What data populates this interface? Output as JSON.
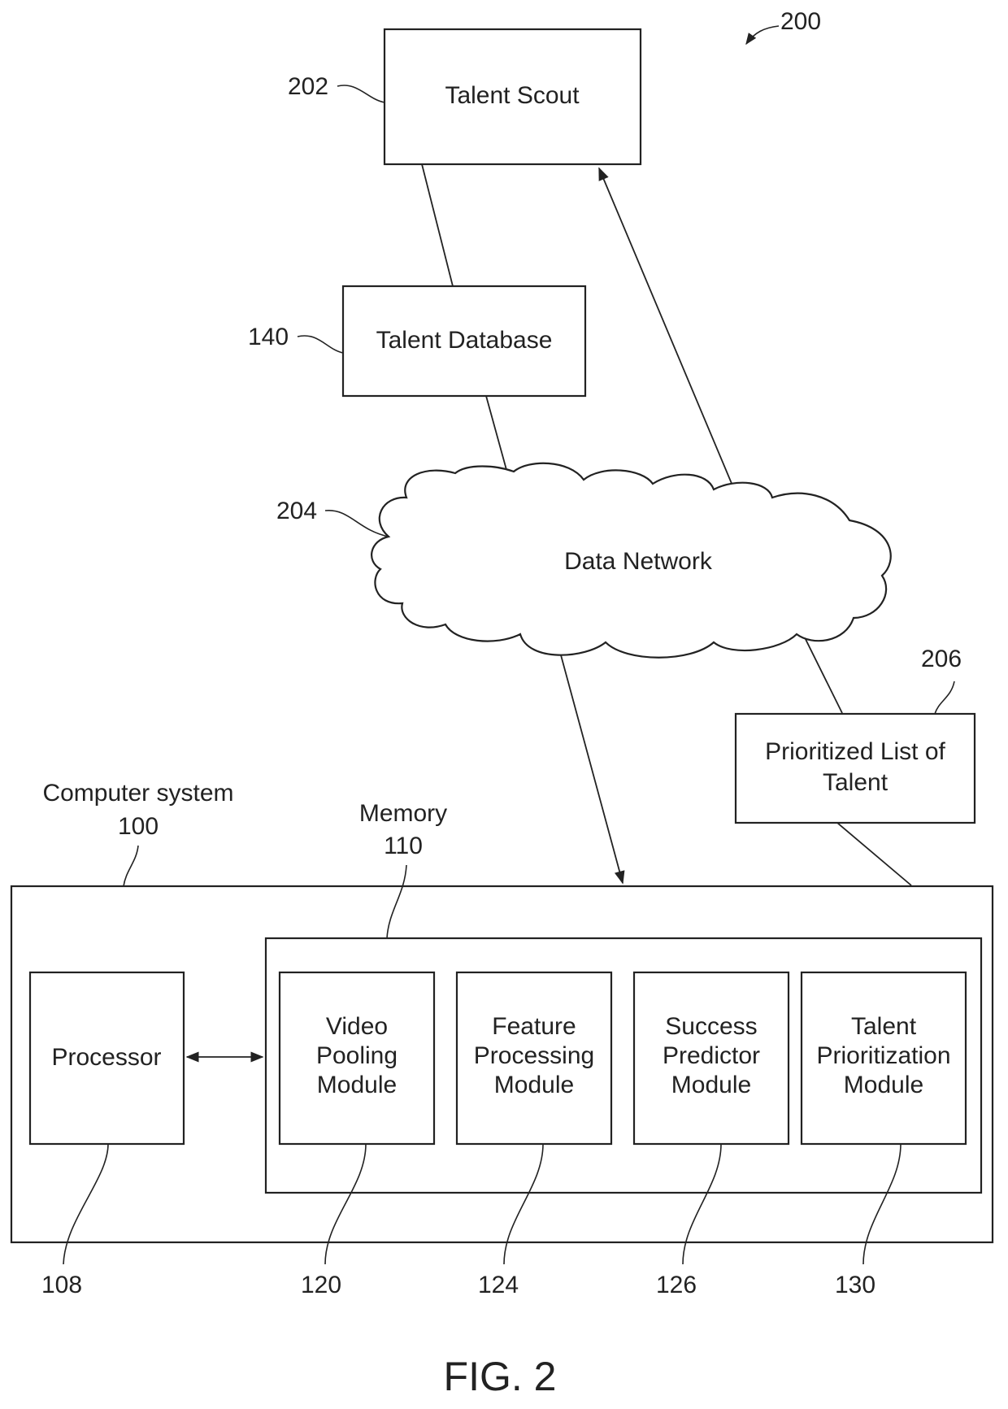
{
  "figure": {
    "caption": "FIG. 2",
    "ref": "200"
  },
  "talent_scout": {
    "label": "Talent Scout",
    "ref": "202"
  },
  "talent_database": {
    "label": "Talent Database",
    "ref": "140"
  },
  "data_network": {
    "label": "Data Network",
    "ref": "204"
  },
  "prioritized_list": {
    "label_line1": "Prioritized List of",
    "label_line2": "Talent",
    "ref": "206"
  },
  "computer_system": {
    "label": "Computer system",
    "ref": "100"
  },
  "memory": {
    "label": "Memory",
    "ref": "110"
  },
  "processor": {
    "label": "Processor",
    "ref": "108"
  },
  "modules": [
    {
      "lines": [
        "Video",
        "Pooling",
        "Module"
      ],
      "ref": "120"
    },
    {
      "lines": [
        "Feature",
        "Processing",
        "Module"
      ],
      "ref": "124"
    },
    {
      "lines": [
        "Success",
        "Predictor",
        "Module"
      ],
      "ref": "126"
    },
    {
      "lines": [
        "Talent",
        "Prioritization",
        "Module"
      ],
      "ref": "130"
    }
  ]
}
